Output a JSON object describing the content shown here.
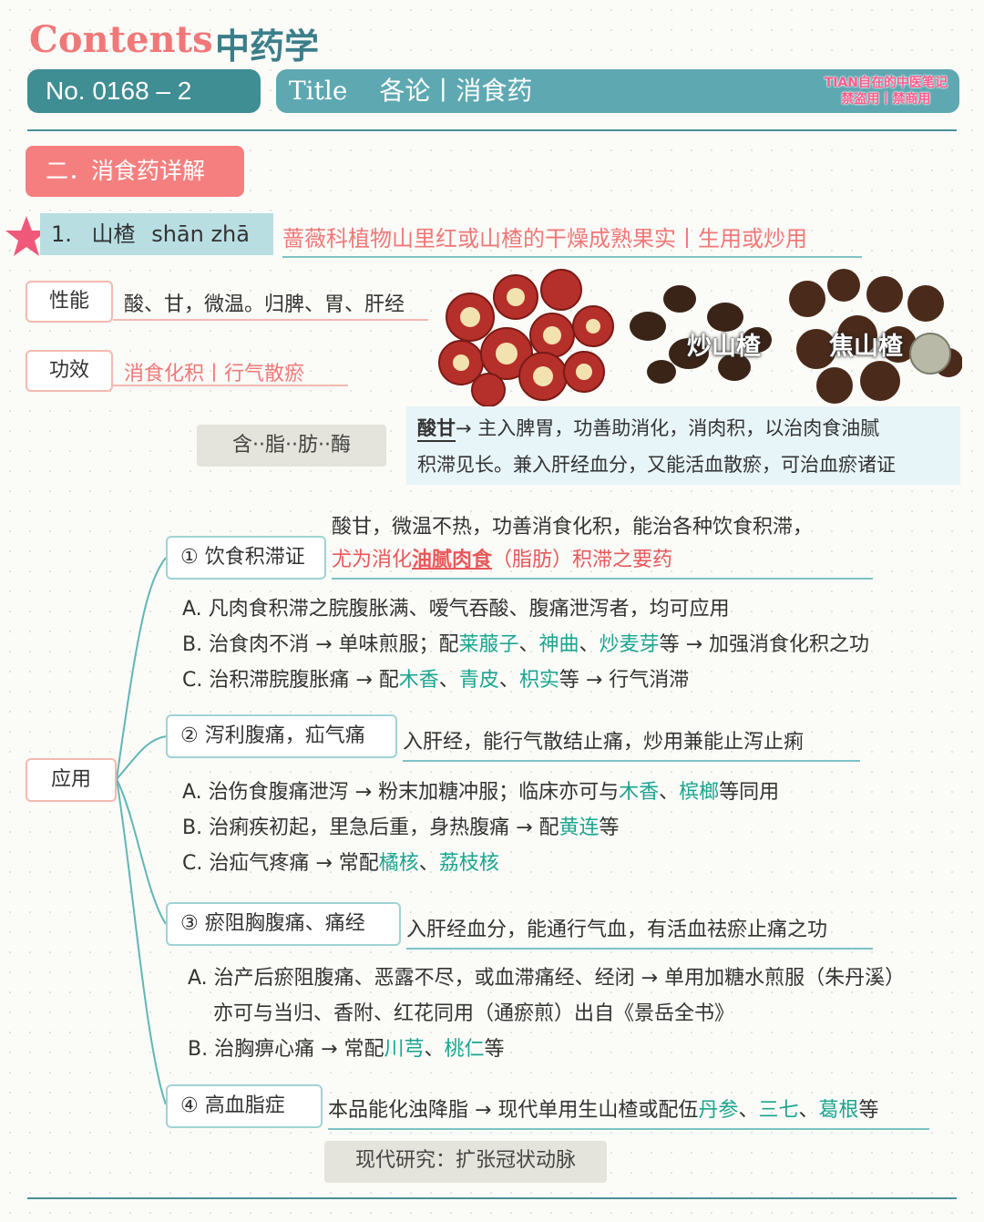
{
  "header": {
    "contents": "Contents",
    "subject": "中药学",
    "number": "No. 0168 – 2",
    "title_label": "Title",
    "title": "各论丨消食药",
    "stamp_line1": "TIAN自在的中医笔记",
    "stamp_line2": "禁盗用丨禁商用"
  },
  "section": "二．消食药详解",
  "herb": {
    "index": "1.",
    "name": "山楂",
    "pinyin": "shān zhā",
    "source": "蔷薇科植物山里红或山楂的干燥成熟果实丨生用或炒用"
  },
  "properties": {
    "label": "性能",
    "text": "酸、甘，微温。归脾、胃、肝经"
  },
  "effects": {
    "label": "功效",
    "text": "消食化积丨行气散瘀"
  },
  "images": {
    "label_chao": "炒山楂",
    "label_jiao": "焦山楂"
  },
  "contains": "含··脂··肪··酶",
  "note": {
    "bold": "酸甘",
    "line1": "→ 主入脾胃，功善助消化，消肉积，以治肉食油腻",
    "line2": "积滞见长。兼入肝经血分，又能活血散瘀，可治血瘀诸证"
  },
  "application_label": "应用",
  "apps": [
    {
      "head": "① 饮食积滞证",
      "desc_line1": "酸甘，微温不热，功善消食化积，能治各种饮食积滞，",
      "desc_a": "尤为消化",
      "desc_b": "油腻肉食",
      "desc_c": "（脂肪）积滞之要药",
      "A": "A. 凡肉食积滞之脘腹胀满、嗳气吞酸、腹痛泄泻者，均可应用",
      "B1": "B. 治食肉不消 → 单味煎服；配",
      "B_h1": "莱菔子",
      "B_h2": "神曲",
      "B_h3": "炒麦芽",
      "B2": "等 → 加强消食化积之功",
      "C1": "C. 治积滞脘腹胀痛 → 配",
      "C_h1": "木香",
      "C_h2": "青皮",
      "C_h3": "枳实",
      "C2": "等 → 行气消滞"
    },
    {
      "head": "② 泻利腹痛，疝气痛",
      "desc": "入肝经，能行气散结止痛，炒用兼能止泻止痢",
      "A1": "A. 治伤食腹痛泄泻 → 粉末加糖冲服；临床亦可与",
      "A_h1": "木香",
      "A_h2": "槟榔",
      "A2": "等同用",
      "B1": "B. 治痢疾初起，里急后重，身热腹痛 → 配",
      "B_h1": "黄连",
      "B2": "等",
      "C1": "C. 治疝气疼痛 → 常配",
      "C_h1": "橘核",
      "C_h2": "荔枝核"
    },
    {
      "head": "③ 瘀阻胸腹痛、痛经",
      "desc": "入肝经血分，能通行气血，有活血祛瘀止痛之功",
      "A": "A. 治产后瘀阻腹痛、恶露不尽，或血滞痛经、经闭 → 单用加糖水煎服（朱丹溪）",
      "A2": "亦可与当归、香附、红花同用（通瘀煎）出自《景岳全书》",
      "B1": "B. 治胸痹心痛 → 常配",
      "B_h1": "川芎",
      "B_h2": "桃仁",
      "B2": "等"
    },
    {
      "head": "④ 高血脂症",
      "desc1": "本品能化浊降脂 → 现代单用生山楂或配伍",
      "h1": "丹参",
      "h2": "三七",
      "h3": "葛根",
      "desc2": "等"
    }
  ],
  "modern": "现代研究：扩张冠状动脉",
  "sep": "、",
  "colors": {
    "accent_pink": "#f07878",
    "teal": "#3f8e94",
    "herb_green": "#1aa58f",
    "red": "#e8575a"
  }
}
